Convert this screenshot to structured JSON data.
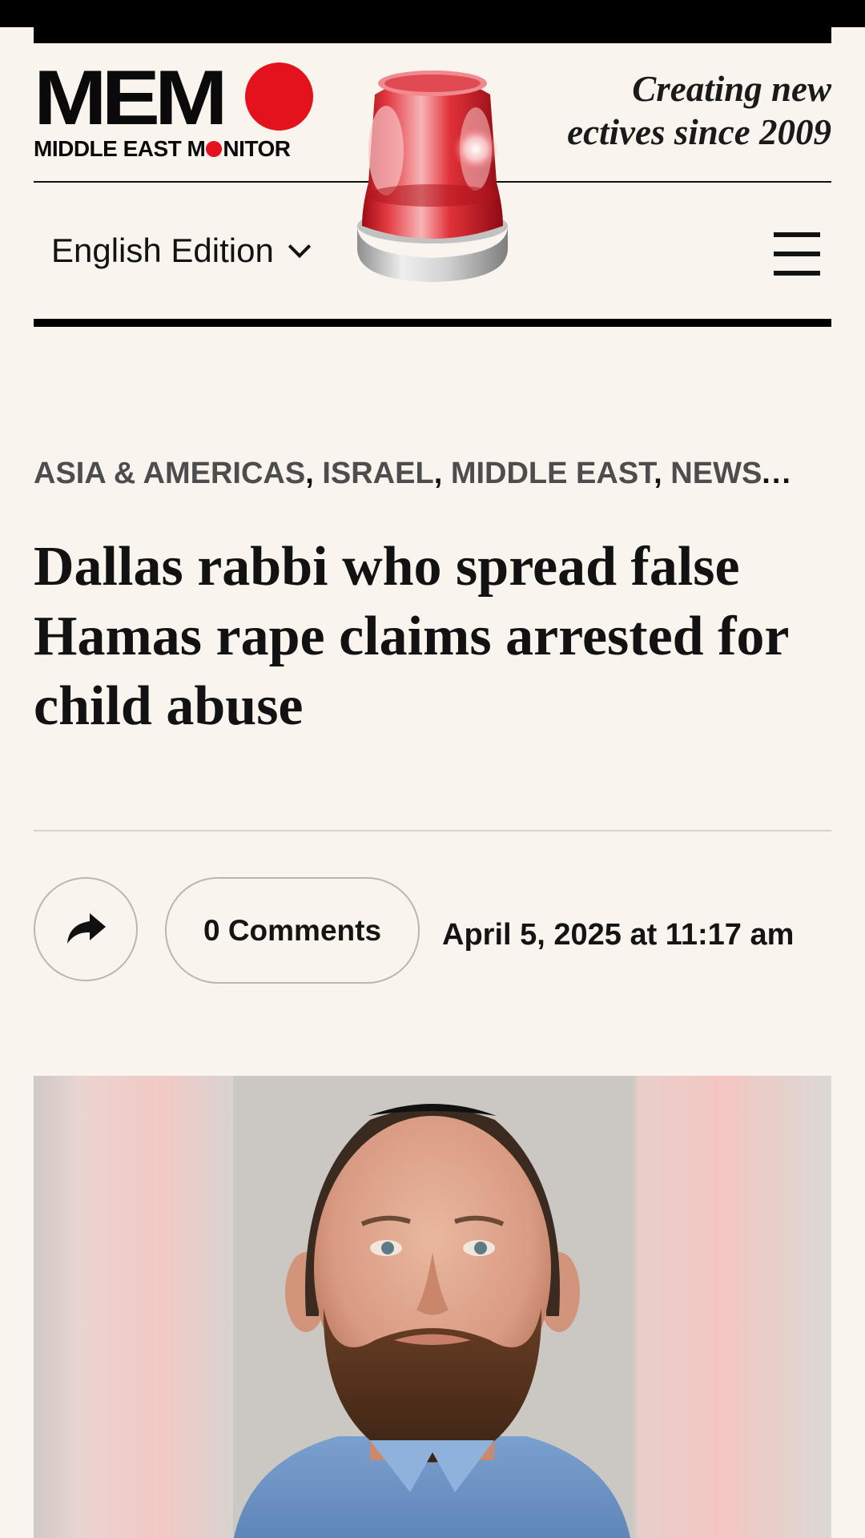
{
  "header": {
    "logo_main": "MEM",
    "logo_sub_before": "MIDDLE EAST M",
    "logo_sub_after": "NITOR",
    "tagline_line1": "Creating new",
    "tagline_line2": "ectives since 2009",
    "edition_label": "English Edition",
    "menu_icon": "hamburger-menu-icon",
    "overlay_icon": "red-siren-light-icon"
  },
  "article": {
    "categories": [
      "ASIA & AMERICAS",
      "ISRAEL",
      "MIDDLE EAST",
      "NEWS"
    ],
    "categories_more": "...",
    "headline": "Dallas rabbi who spread false Hamas rape claims arrested for child abuse",
    "share_icon": "share-arrow-icon",
    "comments_label": "0 Comments",
    "date": "April 5, 2025 at 11:17 am",
    "image": "mugshot-photo"
  },
  "colors": {
    "background": "#faf4ee",
    "brand_red": "#e3121c",
    "text": "#161616",
    "category_gray": "#4d4d4d",
    "photo_background": "#cbc7c2",
    "shirt_blue": "#6f95c4"
  }
}
